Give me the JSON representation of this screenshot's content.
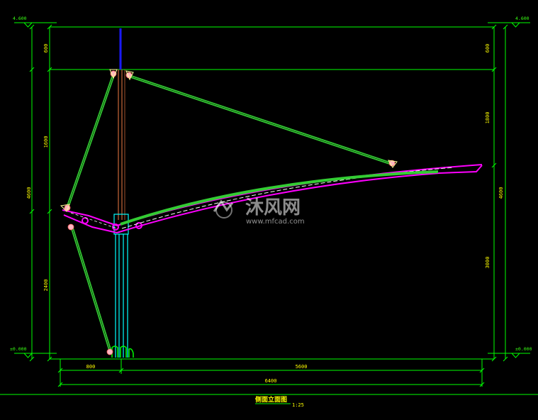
{
  "drawing": {
    "title": "侧面立面图",
    "scale": "1:25",
    "watermark_cn": "沐风网",
    "watermark_en": "www.mfcad.com"
  },
  "levels": {
    "top_left": "4.600",
    "top_right": "4.600",
    "ground_left": "±0.000",
    "ground_right": "±0.000"
  },
  "dimensions": {
    "left_top": "600",
    "left_middle": "1600",
    "left_total": "4600",
    "left_bottom": "2400",
    "right_top": "600",
    "right_middle": "1800",
    "right_total": "4600",
    "right_bottom": "3000",
    "bottom_left": "800",
    "bottom_right": "5600",
    "bottom_total": "6400"
  },
  "colors": {
    "frame": "#00ff00",
    "truss": "#33cc33",
    "membrane": "#ff00ff",
    "column": "#00ffff",
    "mast_top": "#1a1aff",
    "mast": "#a0522d",
    "text": "#ffff00",
    "node": "#ffb6c1"
  }
}
